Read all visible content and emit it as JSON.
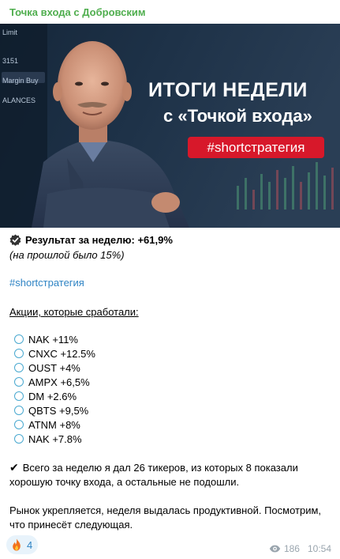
{
  "channel_name": "Точка входа с Добровским",
  "banner": {
    "title_line1": "ИТОГИ НЕДЕЛИ",
    "title_line2": "с «Точкой входа»",
    "tag": "#shortстратегия",
    "bg_text": [
      "Limit",
      "3151",
      "Margin Buy",
      "ALANCES"
    ],
    "accent_color": "#d7182a"
  },
  "result": {
    "icon": "verified-badge-icon",
    "label": "Результат за неделю: +61,9%",
    "previous": "(на прошлой было 15%)"
  },
  "hashtag": "#shortстратегия",
  "stocks_heading": "Акции, которые сработали:",
  "stock_icon": "circle-outline-icon",
  "stocks": [
    "NAK +11%",
    "CNXC +12.5%",
    "OUST +4%",
    "AMPX +6,5%",
    "DM +2.6%",
    "QBTS +9,5%",
    "ATNM +8%",
    "NAK +7.8%"
  ],
  "summary": {
    "icon": "check-mark-icon",
    "text": "Всего за неделю я дал 26 тикеров, из которых 8 показали хорошую точку входа, а остальные не подошли."
  },
  "closing": "Рынок укрепляется, неделя выдалась продуктивной. Посмотрим, что принесёт следующая.",
  "reaction": {
    "icon": "fire-icon",
    "count": "4"
  },
  "views": "186",
  "time": "10:54",
  "colors": {
    "channel": "#4fae4e",
    "link": "#2f84c4",
    "bullet": "#4aa9d0"
  }
}
